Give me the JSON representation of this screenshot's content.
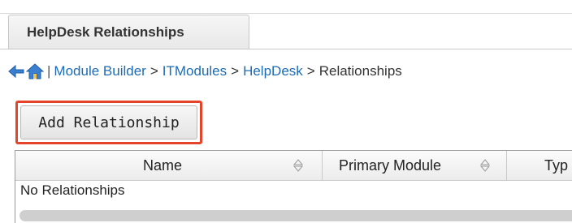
{
  "tab": {
    "label": "HelpDesk Relationships"
  },
  "breadcrumb": {
    "separator": "|",
    "items": [
      {
        "label": "Module Builder"
      },
      {
        "label": "ITModules"
      },
      {
        "label": "HelpDesk"
      }
    ],
    "current": "Relationships",
    "arrow": ">"
  },
  "toolbar": {
    "add_relationship_label": "Add Relationship"
  },
  "table": {
    "columns": [
      "Name",
      "Primary Module",
      "Typ"
    ],
    "empty_message": "No Relationships"
  },
  "colors": {
    "highlight": "#e5432a",
    "link": "#1c6bb4"
  }
}
